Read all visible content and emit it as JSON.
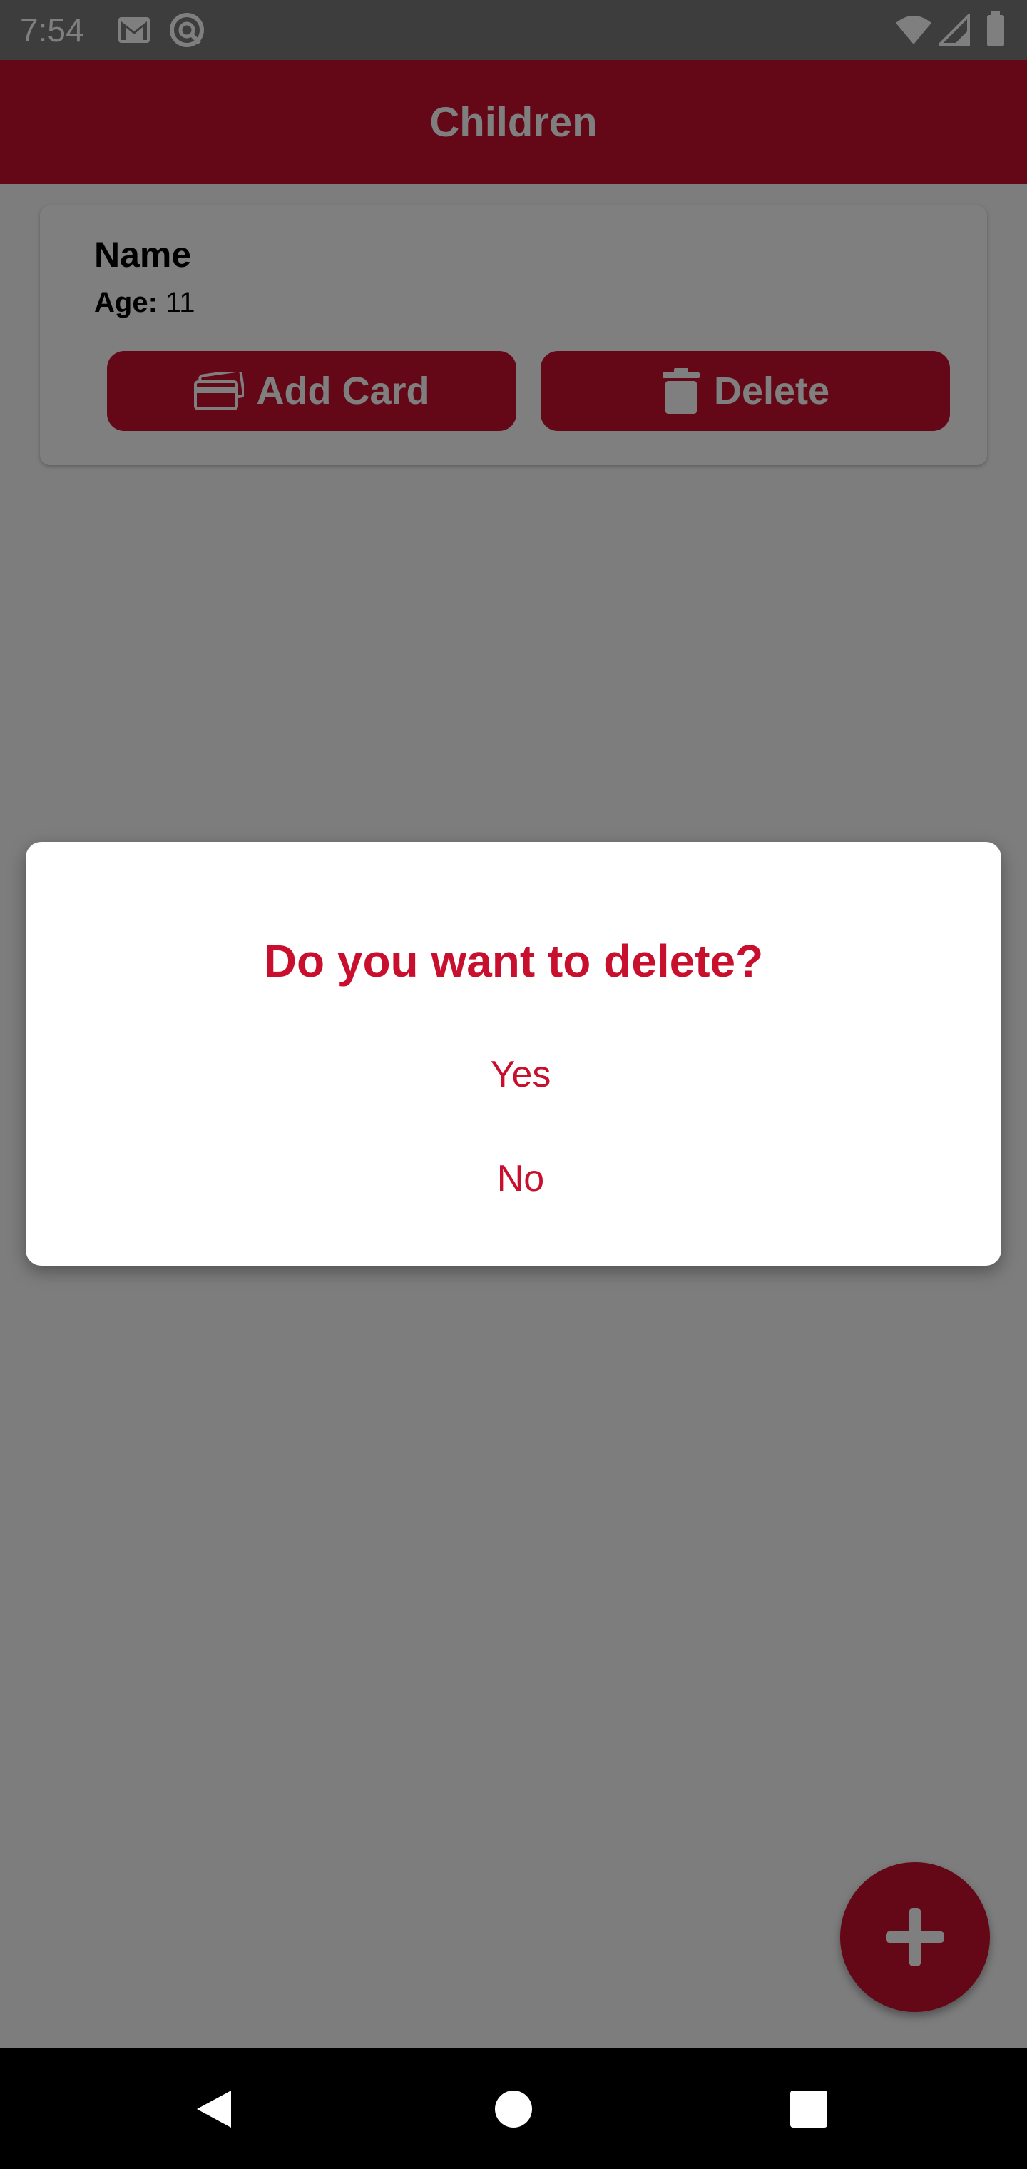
{
  "status_bar": {
    "time": "7:54",
    "icons": [
      "gmail-icon",
      "data-saver-icon",
      "wifi-icon",
      "cell-signal-icon",
      "battery-icon"
    ]
  },
  "app_bar": {
    "title": "Children"
  },
  "child_card": {
    "name": "Name",
    "age_label": "Age:",
    "age_value": "11",
    "add_card_label": "Add Card",
    "delete_label": "Delete"
  },
  "dialog": {
    "title": "Do you want to delete?",
    "yes_label": "Yes",
    "no_label": "No"
  },
  "fab": {
    "icon": "plus-icon"
  },
  "nav_bar": {
    "icons": [
      "back-icon",
      "home-icon",
      "recents-icon"
    ]
  },
  "colors": {
    "primary": "#c8102e",
    "scrim": "rgba(0,0,0,0.5)",
    "dialog_background": "#ffffff"
  }
}
